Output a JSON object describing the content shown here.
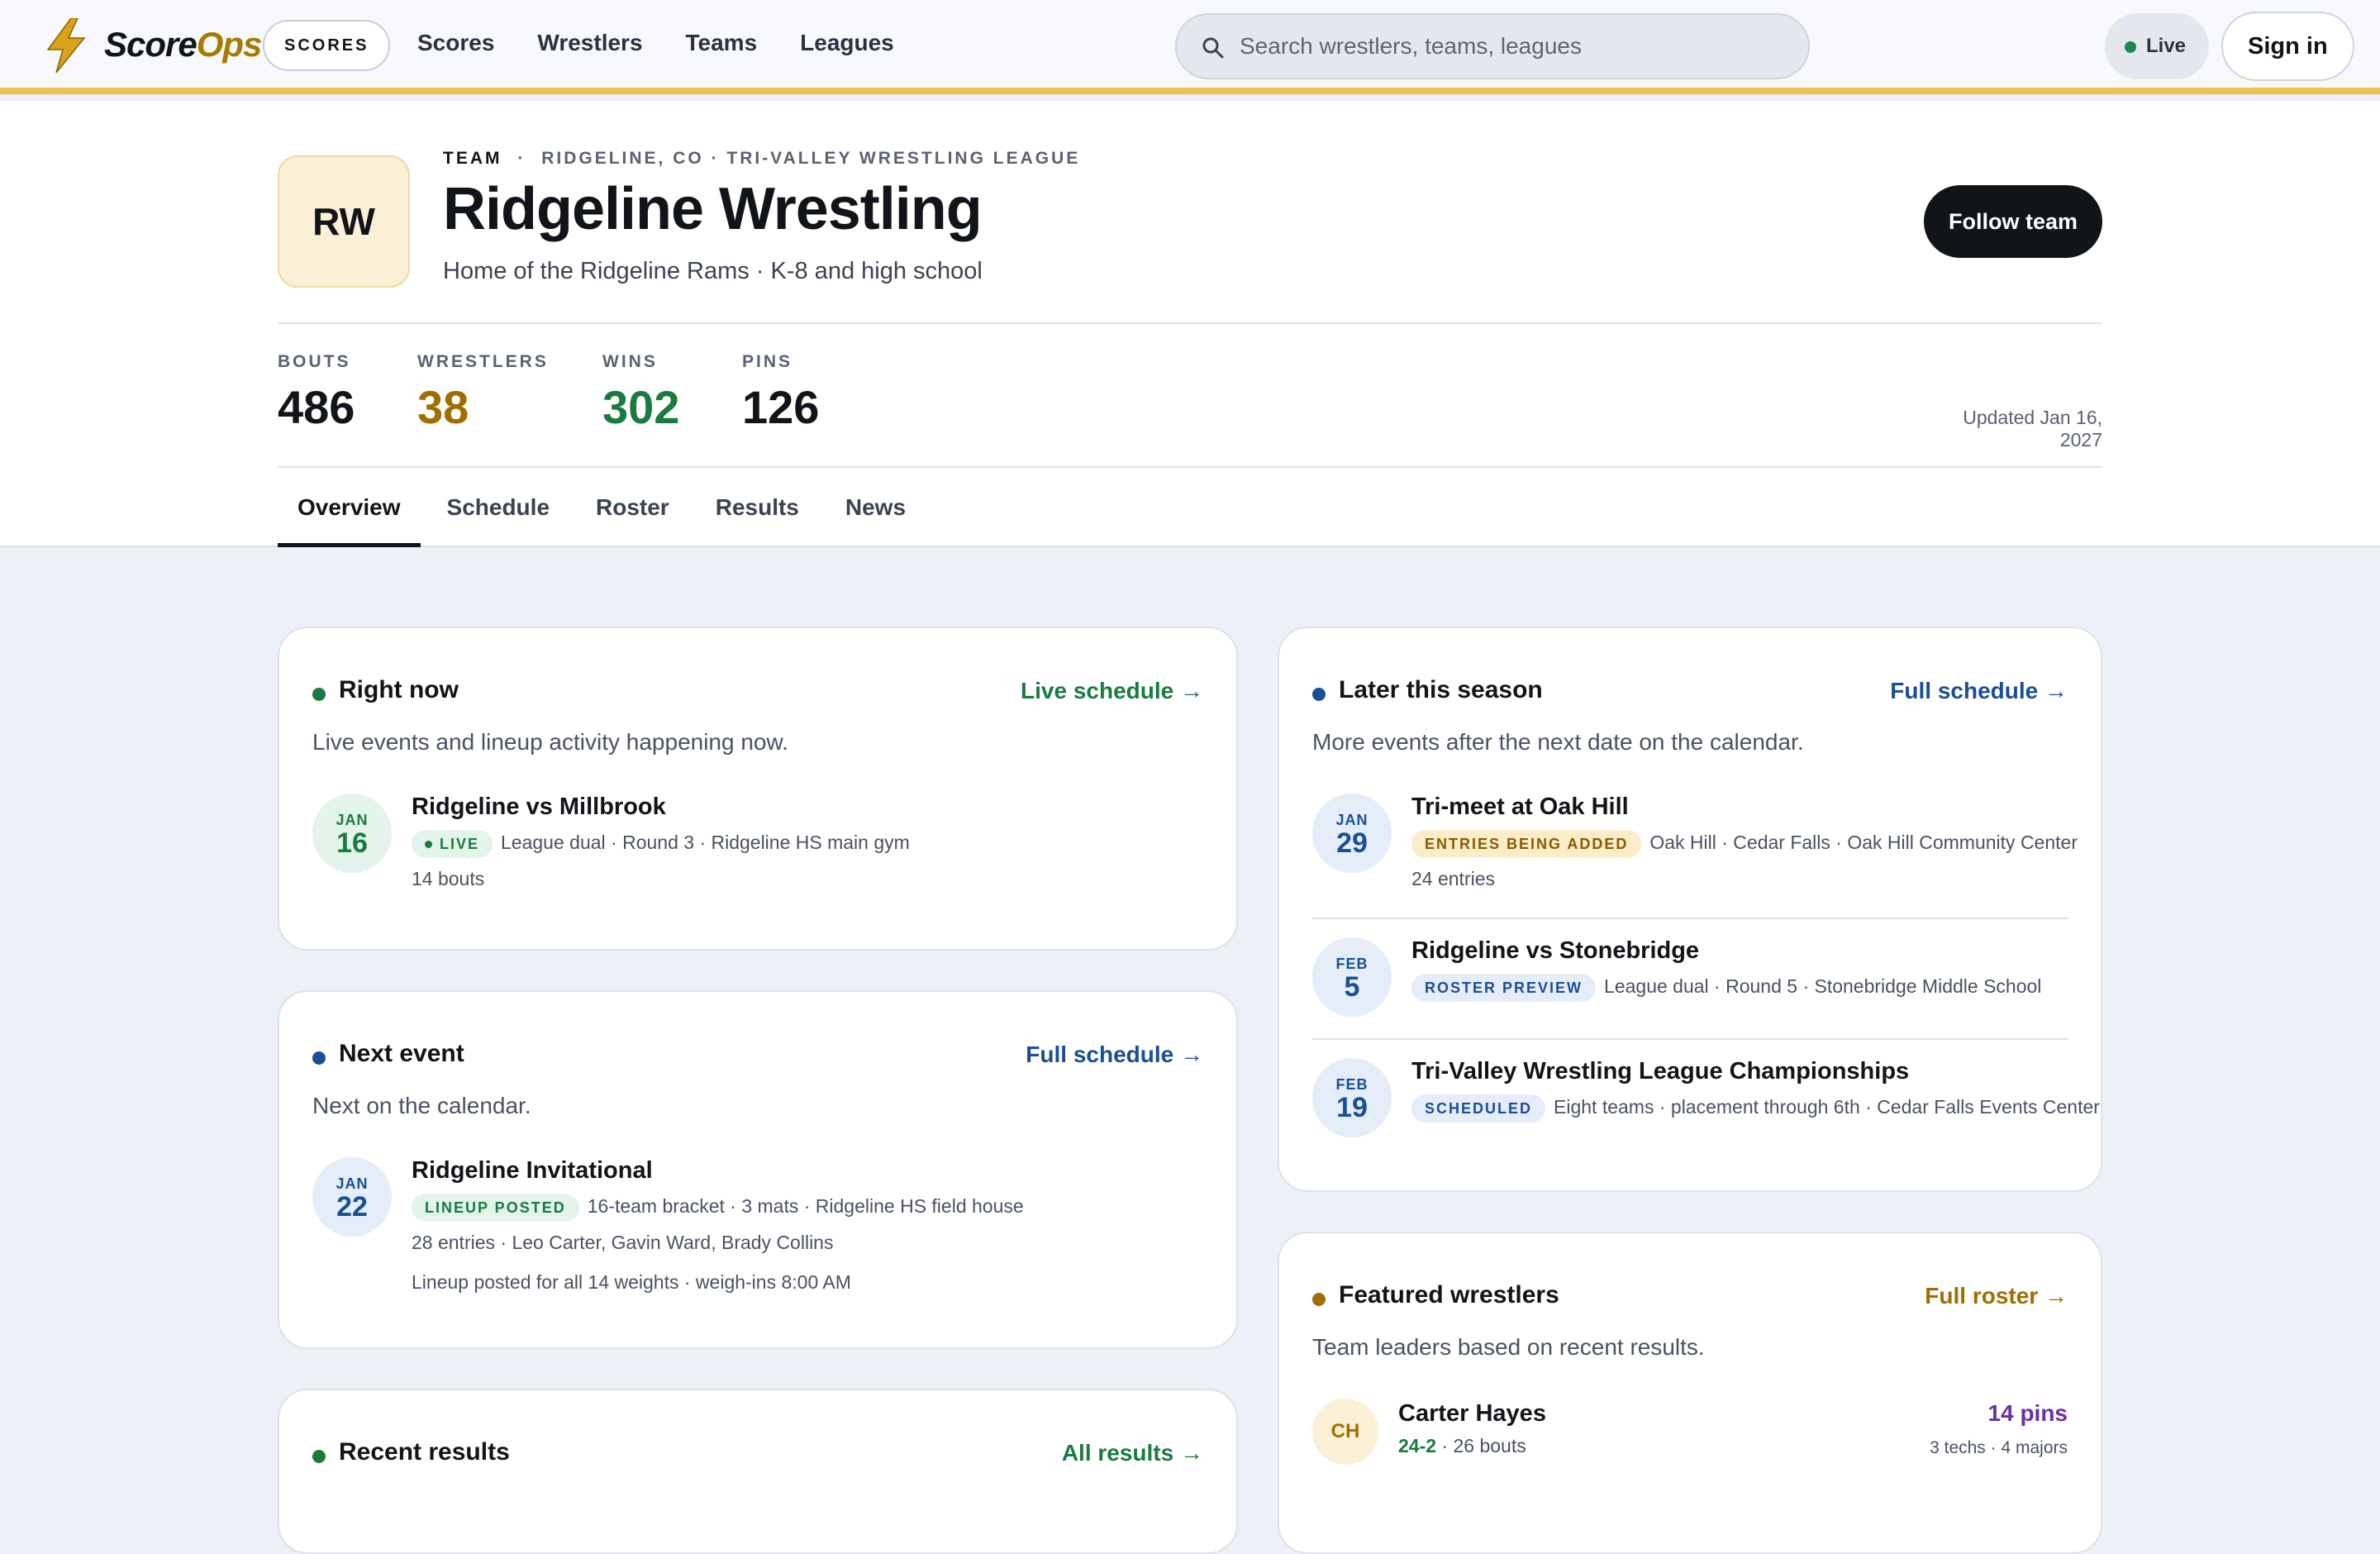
{
  "topbar": {
    "brand_a": "Score",
    "brand_b": "Ops",
    "scores_pill": "SCORES",
    "nav": [
      "Scores",
      "Wrestlers",
      "Teams",
      "Leagues"
    ],
    "search_placeholder": "Search wrestlers, teams, leagues",
    "live_label": "Live",
    "signin_label": "Sign in",
    "colors": {
      "accent": "#f2c14e",
      "logo": "#d9a21a"
    }
  },
  "team": {
    "initials": "RW",
    "eyebrow_tag": "TEAM",
    "eyebrow_sep": "·",
    "eyebrow_location": "RIDGELINE, CO · TRI-VALLEY WRESTLING LEAGUE",
    "name": "Ridgeline Wrestling",
    "tagline": "Home of the Ridgeline Rams · K-8 and high school",
    "follow_label": "Follow team",
    "updated": "Updated Jan 16, 2027"
  },
  "stats": [
    {
      "label": "BOUTS",
      "value": "486"
    },
    {
      "label": "WRESTLERS",
      "value": "38"
    },
    {
      "label": "WINS",
      "value": "302"
    },
    {
      "label": "PINS",
      "value": "126"
    }
  ],
  "tabs": [
    "Overview",
    "Schedule",
    "Roster",
    "Results",
    "News"
  ],
  "right_now": {
    "title": "Right now",
    "link": "Live schedule →",
    "subtitle": "Live events and lineup activity happening now.",
    "event": {
      "month": "JAN",
      "day": "16",
      "title": "Ridgeline vs Millbrook",
      "badge": "LIVE",
      "meta": "League dual · Round 3 · Ridgeline HS main gym",
      "line2": "14 bouts"
    }
  },
  "next_event": {
    "title": "Next event",
    "link": "Full schedule →",
    "subtitle": "Next on the calendar.",
    "event": {
      "month": "JAN",
      "day": "22",
      "title": "Ridgeline Invitational",
      "badge": "LINEUP POSTED",
      "meta": "16-team bracket · 3 mats · Ridgeline HS field house",
      "line2": "28 entries · Leo Carter, Gavin Ward, Brady Collins",
      "line3": "Lineup posted for all 14 weights · weigh-ins 8:00 AM"
    }
  },
  "recent_results": {
    "title": "Recent results",
    "link": "All results →"
  },
  "later": {
    "title": "Later this season",
    "link": "Full schedule →",
    "subtitle": "More events after the next date on the calendar.",
    "events": [
      {
        "month": "JAN",
        "day": "29",
        "title": "Tri-meet at Oak Hill",
        "badge": "ENTRIES BEING ADDED",
        "meta": "Oak Hill · Cedar Falls · Oak Hill Community Center",
        "line2": "24 entries"
      },
      {
        "month": "FEB",
        "day": "5",
        "title": "Ridgeline vs Stonebridge",
        "badge": "ROSTER PREVIEW",
        "meta": "League dual · Round 5 · Stonebridge Middle School"
      },
      {
        "month": "FEB",
        "day": "19",
        "title": "Tri-Valley Wrestling League Championships",
        "badge": "SCHEDULED",
        "meta": "Eight teams · placement through 6th · Cedar Falls Events Center"
      }
    ]
  },
  "featured": {
    "title": "Featured wrestlers",
    "link": "Full roster →",
    "subtitle": "Team leaders based on recent results.",
    "wrestler": {
      "initials": "CH",
      "name": "Carter Hayes",
      "record": "24-2",
      "bouts": " · 26 bouts",
      "stat": "14 pins",
      "stat_detail": "3 techs · 4 majors"
    }
  }
}
